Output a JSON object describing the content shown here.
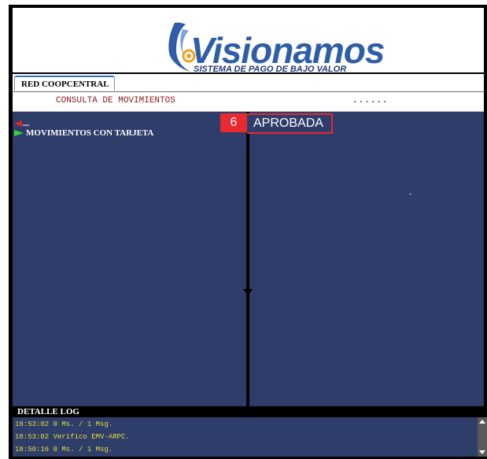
{
  "header": {
    "logo_word": "Visionamos",
    "logo_tagline": "SISTEMA DE PAGO DE BAJO VALOR"
  },
  "tabs": [
    {
      "label": "RED COOPCENTRAL"
    }
  ],
  "title_row": {
    "title": "CONSULTA DE MOVIMIENTOS",
    "dots": "......"
  },
  "nav": {
    "back": {
      "icon": "red-back-arrow-icon",
      "label": "..."
    },
    "item": {
      "icon": "green-forward-arrow-icon",
      "label": "MOVIMIENTOS CON TARJETA"
    }
  },
  "status": {
    "number": "6",
    "label": "APROBADA"
  },
  "log": {
    "heading": "DETALLE LOG",
    "lines": [
      "18:53:02 0 Ms. / 1 Msg.",
      "18:53:02 Verifico EMV-ARPC.",
      "18:50:16 0 Ms. / 1 Msg."
    ]
  },
  "colors": {
    "panel": "#2e3d6a",
    "badge": "#e8292f",
    "log_text": "#e8dc3a",
    "title_text": "#8b1a1a",
    "logo_blue": "#2e5ea8"
  }
}
